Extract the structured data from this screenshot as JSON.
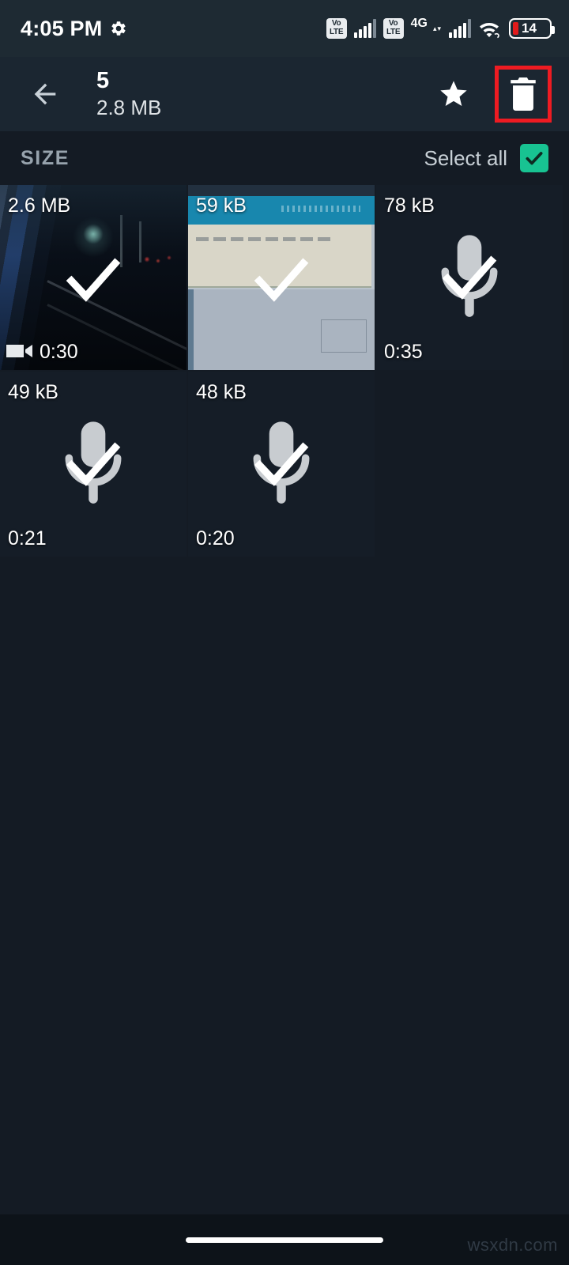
{
  "status_bar": {
    "time": "4:05 PM",
    "gear_icon": "gear-icon",
    "volte_label_1": "VoLTE",
    "volte_line1": "Vo",
    "volte_line2": "LTE",
    "network_type": "4G",
    "wifi_icon": "wifi-icon",
    "battery_percent": "14"
  },
  "app_bar": {
    "back_icon": "back-arrow-icon",
    "selected_count": "5",
    "selected_size": "2.8 MB",
    "star_icon": "star-icon",
    "delete_icon": "trash-icon",
    "highlight_color": "#ee1b22"
  },
  "toolbar": {
    "sort_label": "SIZE",
    "select_all_label": "Select all",
    "select_all_checked": true,
    "accent_color": "#18c392"
  },
  "grid": {
    "items": [
      {
        "size": "2.6 MB",
        "duration": "0:30",
        "type": "video",
        "selected": true,
        "thumb": "train-night-thumbnail"
      },
      {
        "size": "59 kB",
        "duration": "",
        "type": "image",
        "selected": true,
        "thumb": "document-screenshot-thumbnail"
      },
      {
        "size": "78 kB",
        "duration": "0:35",
        "type": "audio",
        "selected": true,
        "thumb": "microphone-icon"
      },
      {
        "size": "49 kB",
        "duration": "0:21",
        "type": "audio",
        "selected": true,
        "thumb": "microphone-icon"
      },
      {
        "size": "48 kB",
        "duration": "0:20",
        "type": "audio",
        "selected": true,
        "thumb": "microphone-icon"
      }
    ]
  },
  "nav_bar": {
    "home_pill": "gesture-home-pill"
  },
  "watermark": {
    "text": "wsxdn.com"
  }
}
